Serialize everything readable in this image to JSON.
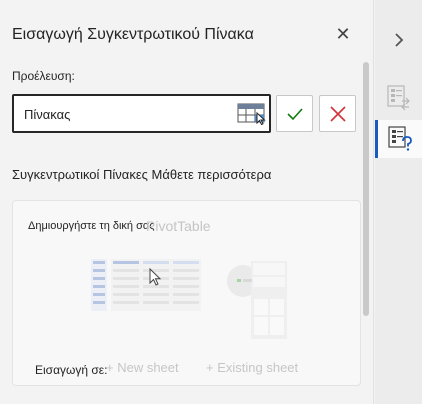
{
  "pane": {
    "title": "Εισαγωγή Συγκεντρωτικού Πίνακα",
    "close_icon": "close-icon"
  },
  "source": {
    "label": "Προέλευση:",
    "value": "Πίνακας",
    "picker_icon": "table-range-picker-icon",
    "confirm_icon": "checkmark-icon",
    "cancel_icon": "x-icon"
  },
  "section": {
    "heading": "Συγκεντρωτικοί Πίνακες Μάθετε περισσότερα"
  },
  "card": {
    "title_part1": "Δημιουργήστε τη δική σας",
    "title_part2": "PivotTable",
    "insert_label": "Εισαγωγή σε:",
    "new_sheet": "+ New sheet",
    "existing_sheet": "+ Existing sheet"
  },
  "rail": {
    "expand_icon": "chevron-right-icon",
    "items": [
      "pivot-fields-icon",
      "pivot-help-icon"
    ]
  },
  "colors": {
    "accent": "#185abd",
    "confirm": "#107c10",
    "cancel": "#d13438"
  }
}
